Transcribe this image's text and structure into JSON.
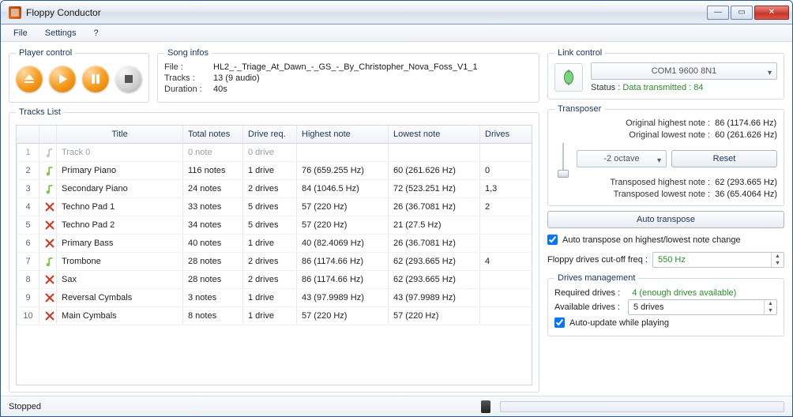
{
  "window": {
    "title": "Floppy Conductor"
  },
  "menu": {
    "file": "File",
    "settings": "Settings",
    "help": "?"
  },
  "player": {
    "legend": "Player control"
  },
  "song": {
    "legend": "Song infos",
    "file_k": "File :",
    "file_v": "HL2_-_Triage_At_Dawn_-_GS_-_By_Christopher_Nova_Foss_V1_1",
    "tracks_k": "Tracks :",
    "tracks_v": "13 (9 audio)",
    "duration_k": "Duration :",
    "duration_v": "40s"
  },
  "tracks": {
    "legend": "Tracks List",
    "headers": {
      "title": "Title",
      "total": "Total notes",
      "req": "Drive req.",
      "high": "Highest note",
      "low": "Lowest note",
      "drives": "Drives"
    },
    "rows": [
      {
        "idx": "1",
        "state": "muted",
        "title": "Track 0",
        "total": "0 note",
        "req": "0 drive",
        "high": "",
        "low": "",
        "drives": ""
      },
      {
        "idx": "2",
        "state": "on",
        "title": "Primary Piano",
        "total": "116 notes",
        "req": "1 drive",
        "high": "76 (659.255 Hz)",
        "low": "60 (261.626 Hz)",
        "drives": "0"
      },
      {
        "idx": "3",
        "state": "on",
        "title": "Secondary Piano",
        "total": "24 notes",
        "req": "2 drives",
        "high": "84 (1046.5 Hz)",
        "low": "72 (523.251 Hz)",
        "drives": "1,3"
      },
      {
        "idx": "4",
        "state": "off",
        "title": "Techno Pad 1",
        "total": "33 notes",
        "req": "5 drives",
        "high": "57 (220 Hz)",
        "low": "26 (36.7081 Hz)",
        "drives": "2"
      },
      {
        "idx": "5",
        "state": "off",
        "title": "Techno Pad 2",
        "total": "34 notes",
        "req": "5 drives",
        "high": "57 (220 Hz)",
        "low": "21 (27.5 Hz)",
        "drives": ""
      },
      {
        "idx": "6",
        "state": "off",
        "title": "Primary Bass",
        "total": "40 notes",
        "req": "1 drive",
        "high": "40 (82.4069 Hz)",
        "low": "26 (36.7081 Hz)",
        "drives": ""
      },
      {
        "idx": "7",
        "state": "on",
        "title": "Trombone",
        "total": "28 notes",
        "req": "2 drives",
        "high": "86 (1174.66 Hz)",
        "low": "62 (293.665 Hz)",
        "drives": "4"
      },
      {
        "idx": "8",
        "state": "off",
        "title": "Sax",
        "total": "28 notes",
        "req": "2 drives",
        "high": "86 (1174.66 Hz)",
        "low": "62 (293.665 Hz)",
        "drives": ""
      },
      {
        "idx": "9",
        "state": "off",
        "title": "Reversal Cymbals",
        "total": "3 notes",
        "req": "1 drive",
        "high": "43 (97.9989 Hz)",
        "low": "43 (97.9989 Hz)",
        "drives": ""
      },
      {
        "idx": "10",
        "state": "off",
        "title": "Main Cymbals",
        "total": "8 notes",
        "req": "1 drive",
        "high": "57 (220 Hz)",
        "low": "57 (220 Hz)",
        "drives": ""
      }
    ]
  },
  "link": {
    "legend": "Link control",
    "port": "COM1 9600 8N1",
    "status_lbl": "Status : ",
    "status_val": "Data transmitted : 84"
  },
  "transposer": {
    "legend": "Transposer",
    "orig_high_k": "Original highest note :",
    "orig_high_v": "86 (1174.66 Hz)",
    "orig_low_k": "Original lowest note :",
    "orig_low_v": "60 (261.626 Hz)",
    "octave": "-2 octave",
    "reset": "Reset",
    "tr_high_k": "Transposed highest note :",
    "tr_high_v": "62 (293.665 Hz)",
    "tr_low_k": "Transposed lowest note :",
    "tr_low_v": "36 (65.4064 Hz)",
    "auto_btn": "Auto transpose",
    "auto_chk": "Auto transpose on highest/lowest note change",
    "cutoff_k": "Floppy drives cut-off freq :",
    "cutoff_v": "550 Hz"
  },
  "drives": {
    "legend": "Drives management",
    "req_k": "Required drives :",
    "req_v": "4 (enough drives available)",
    "avail_k": "Available drives :",
    "avail_v": "5 drives",
    "auto_update": "Auto-update while playing"
  },
  "status": {
    "text": "Stopped"
  }
}
